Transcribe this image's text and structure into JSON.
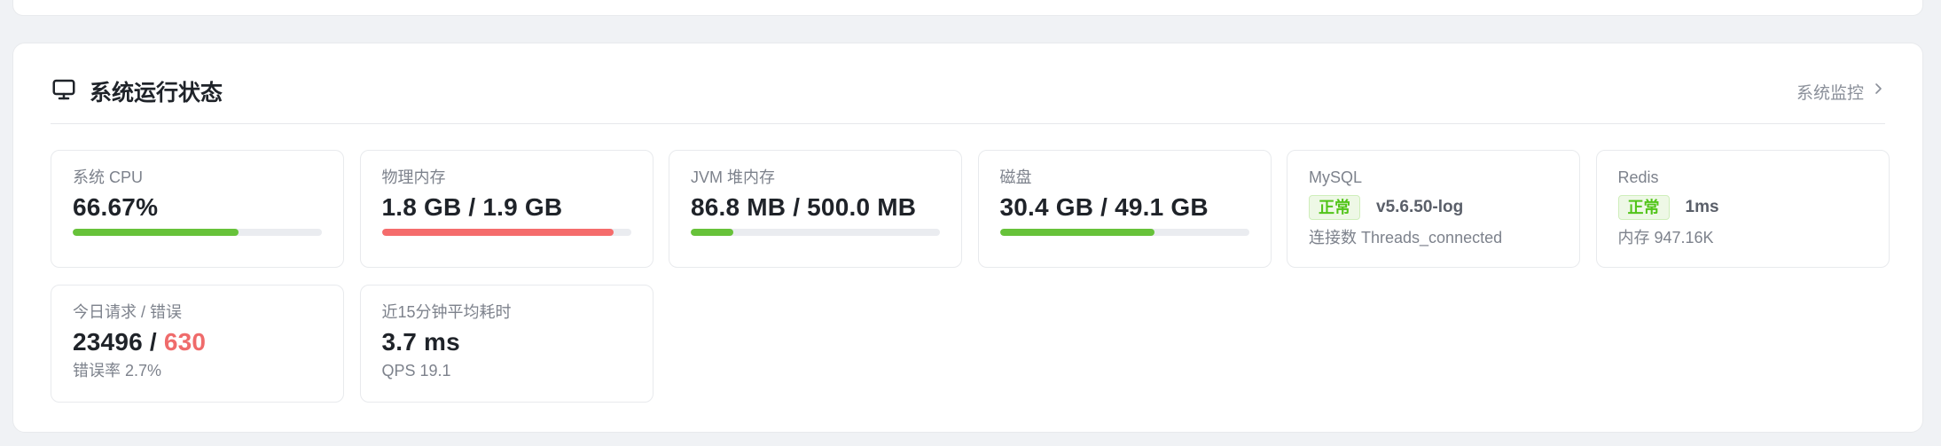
{
  "panel": {
    "title": "系统运行状态",
    "monitor_link": "系统监控",
    "icons": {
      "title": "monitor-icon",
      "link": "chevron-right-icon"
    },
    "colors": {
      "green": "#67c23a",
      "red": "#f56c6c",
      "track": "#eaecf0"
    }
  },
  "cards": {
    "cpu": {
      "label": "系统 CPU",
      "value": "66.67%",
      "progress": 0.6667,
      "color": "#67c23a"
    },
    "memory": {
      "label": "物理内存",
      "value": "1.8 GB / 1.9 GB",
      "progress": 0.93,
      "color": "#f56c6c"
    },
    "jvm": {
      "label": "JVM 堆内存",
      "value": "86.8 MB / 500.0 MB",
      "progress": 0.17,
      "color": "#67c23a"
    },
    "disk": {
      "label": "磁盘",
      "value": "30.4 GB / 49.1 GB",
      "progress": 0.62,
      "color": "#67c23a"
    },
    "mysql": {
      "label": "MySQL",
      "status": "正常",
      "version": "v5.6.50-log",
      "sub": "连接数 Threads_connected"
    },
    "redis": {
      "label": "Redis",
      "status": "正常",
      "latency": "1ms",
      "sub": "内存 947.16K"
    },
    "requests": {
      "label": "今日请求 / 错误",
      "total": "23496 /",
      "errors": "630",
      "sub": "错误率 2.7%"
    },
    "latency": {
      "label": "近15分钟平均耗时",
      "value": "3.7 ms",
      "sub": "QPS 19.1"
    }
  }
}
